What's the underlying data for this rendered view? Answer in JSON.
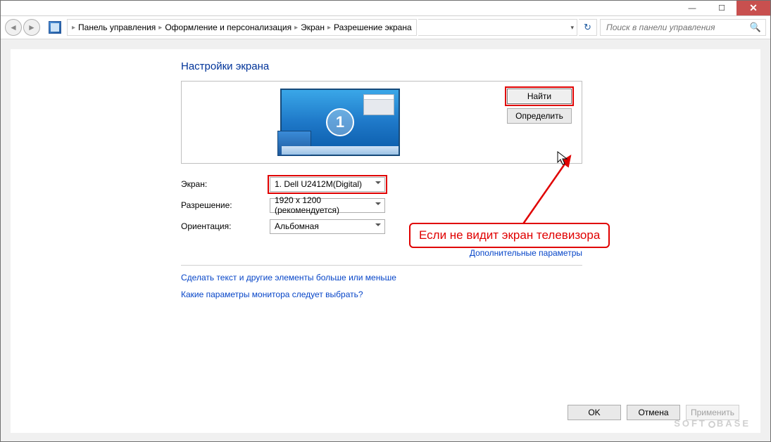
{
  "titlebar": {
    "min": "—",
    "max": "☐",
    "close": "✕"
  },
  "breadcrumb": {
    "items": [
      "Панель управления",
      "Оформление и персонализация",
      "Экран",
      "Разрешение экрана"
    ]
  },
  "search": {
    "placeholder": "Поиск в панели управления"
  },
  "page": {
    "title": "Настройки экрана"
  },
  "preview": {
    "display_number": "1"
  },
  "buttons": {
    "find": "Найти",
    "detect": "Определить",
    "ok": "OK",
    "cancel": "Отмена",
    "apply": "Применить"
  },
  "form": {
    "display_label": "Экран:",
    "display_value": "1. Dell U2412M(Digital)",
    "resolution_label": "Разрешение:",
    "resolution_value": "1920 x 1200 (рекомендуется)",
    "orientation_label": "Ориентация:",
    "orientation_value": "Альбомная"
  },
  "links": {
    "advanced": "Дополнительные параметры",
    "text_size": "Сделать текст и другие элементы больше или меньше",
    "which_settings": "Какие параметры монитора следует выбрать?"
  },
  "annotation": {
    "text": "Если не видит экран телевизора"
  },
  "watermark": {
    "a": "SOFT",
    "b": "BASE"
  }
}
